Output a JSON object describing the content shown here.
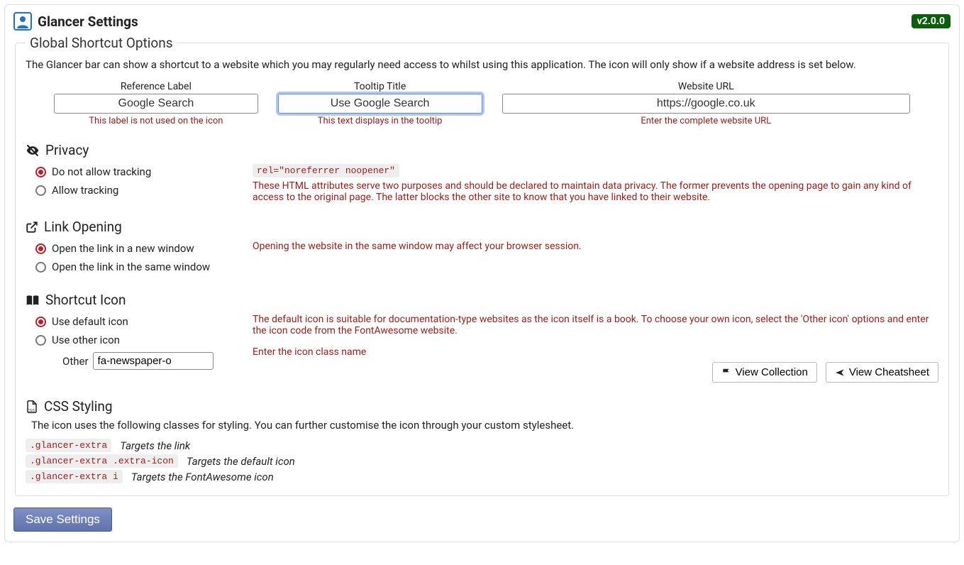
{
  "header": {
    "title": "Glancer Settings",
    "version": "v2.0.0"
  },
  "fieldset_legend": "Global Shortcut Options",
  "intro": "The Glancer bar can show a shortcut to a website which you may regularly need access to whilst using this application. The icon will only show if a website address is set below.",
  "fields": {
    "reference": {
      "label": "Reference Label",
      "value": "Google Search",
      "hint": "This label is not used on the icon"
    },
    "tooltip": {
      "label": "Tooltip Title",
      "value": "Use Google Search",
      "hint": "This text displays in the tooltip"
    },
    "url": {
      "label": "Website URL",
      "value": "https://google.co.uk",
      "hint": "Enter the complete website URL"
    }
  },
  "privacy": {
    "heading": "Privacy",
    "option_no_track": "Do not allow tracking",
    "option_allow_track": "Allow tracking",
    "code": "rel=\"noreferrer noopener\"",
    "note": "These HTML attributes serve two purposes and should be declared to maintain data privacy. The former prevents the opening page to gain any kind of access to the original page. The latter blocks the other site to know that you have linked to their website."
  },
  "link_opening": {
    "heading": "Link Opening",
    "option_new": "Open the link in a new window",
    "option_same": "Open the link in the same window",
    "note": "Opening the website in the same window may affect your browser session."
  },
  "shortcut_icon": {
    "heading": "Shortcut Icon",
    "option_default": "Use default icon",
    "option_other": "Use other icon",
    "other_label": "Other",
    "other_value": "fa-newspaper-o",
    "note1": "The default icon is suitable for documentation-type websites as the icon itself is a book. To choose your own icon, select the 'Other icon' options and enter the icon code from the FontAwesome website.",
    "note2": "Enter the icon class name",
    "btn_collection": "View Collection",
    "btn_cheatsheet": "View Cheatsheet"
  },
  "css": {
    "heading": "CSS Styling",
    "desc": "The icon uses the following classes for styling. You can further customise the icon through your custom stylesheet.",
    "rows": [
      {
        "code": ".glancer-extra",
        "target": "Targets the link"
      },
      {
        "code": ".glancer-extra .extra-icon",
        "target": "Targets the default icon"
      },
      {
        "code": ".glancer-extra i",
        "target": "Targets the FontAwesome icon"
      }
    ]
  },
  "save_label": "Save Settings"
}
